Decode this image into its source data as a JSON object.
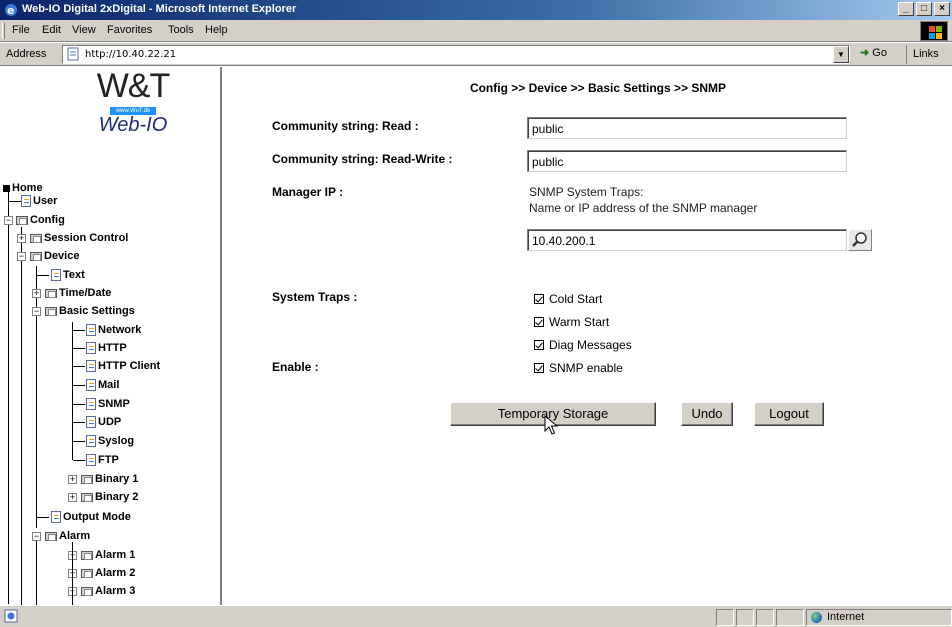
{
  "window": {
    "title": "Web-IO Digital 2xDigital - Microsoft Internet Explorer",
    "buttons": [
      "_",
      "□",
      "×"
    ]
  },
  "menu": [
    "File",
    "Edit",
    "View",
    "Favorites",
    "Tools",
    "Help"
  ],
  "address": {
    "label": "Address",
    "url": "http://10.40.22.21",
    "go_label": "Go",
    "links_label": "Links"
  },
  "logo": {
    "brand": "W&T",
    "url": "www.WuT.de",
    "product": "Web-IO"
  },
  "tree": {
    "home": "Home",
    "user": "User",
    "config": "Config",
    "session_control": "Session Control",
    "device": "Device",
    "text": "Text",
    "time_date": "Time/Date",
    "basic_settings": "Basic Settings",
    "network": "Network",
    "http": "HTTP",
    "http_client": "HTTP Client",
    "mail": "Mail",
    "snmp": "SNMP",
    "udp": "UDP",
    "syslog": "Syslog",
    "ftp": "FTP",
    "binary1": "Binary 1",
    "binary2": "Binary 2",
    "output_mode": "Output Mode",
    "alarm": "Alarm",
    "alarm1": "Alarm 1",
    "alarm2": "Alarm 2",
    "alarm3": "Alarm 3"
  },
  "form": {
    "breadcrumb": "Config >> Device >> Basic Settings >> SNMP",
    "community_read_label": "Community string: Read :",
    "community_read_value": "public",
    "community_rw_label": "Community string: Read-Write :",
    "community_rw_value": "public",
    "manager_ip_label": "Manager IP :",
    "manager_hint_line1": "SNMP System Traps:",
    "manager_hint_line2": "Name or IP address of the SNMP manager",
    "manager_ip_value": "10.40.200.1",
    "system_traps_label": "System Traps :",
    "traps": [
      {
        "label": "Cold Start",
        "checked": true
      },
      {
        "label": "Warm Start",
        "checked": true
      },
      {
        "label": "Diag Messages",
        "checked": true
      }
    ],
    "enable_label": "Enable :",
    "snmp_enable_label": "SNMP enable",
    "snmp_enable_checked": true,
    "buttons": {
      "temporary_storage": "Temporary Storage",
      "undo": "Undo",
      "logout": "Logout"
    }
  },
  "status": {
    "zone": "Internet"
  }
}
